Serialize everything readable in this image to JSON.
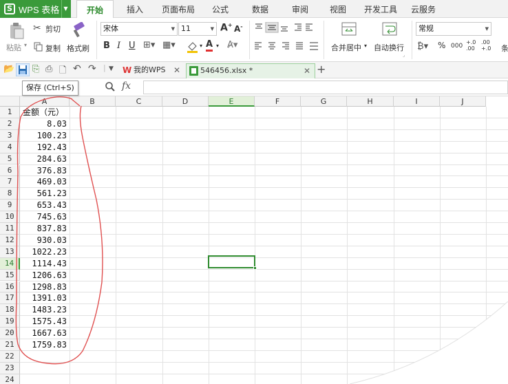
{
  "app": {
    "name": "WPS 表格",
    "logo_letter": "S"
  },
  "menu_tabs": [
    "开始",
    "插入",
    "页面布局",
    "公式",
    "数据",
    "审阅",
    "视图",
    "开发工具",
    "云服务"
  ],
  "active_menu_tab": "开始",
  "ribbon": {
    "paste": "粘贴",
    "cut": "剪切",
    "copy": "复制",
    "format_painter": "格式刷",
    "font_name": "宋体",
    "font_size": "11",
    "merge_center": "合并居中",
    "auto_wrap": "自动换行",
    "number_format": "常规",
    "percent": "%",
    "comma": "000",
    "inc_decimal": "+.0 .00",
    "dec_decimal": ".00 +.0",
    "cond_fmt_partial": "条"
  },
  "doc_tabs": [
    {
      "label": "我的WPS",
      "active": false
    },
    {
      "label": "546456.xlsx *",
      "active": true
    }
  ],
  "tooltip": "保存 (Ctrl+S)",
  "formula_bar": {
    "fx": "fx",
    "value": ""
  },
  "sheet": {
    "columns": [
      "A",
      "B",
      "C",
      "D",
      "E",
      "F",
      "G",
      "H",
      "I",
      "J"
    ],
    "selected_column": "E",
    "selected_row": "14",
    "rows": [
      "1",
      "2",
      "3",
      "4",
      "5",
      "6",
      "7",
      "8",
      "9",
      "10",
      "11",
      "12",
      "13",
      "14",
      "15",
      "16",
      "17",
      "18",
      "19",
      "20",
      "21",
      "22",
      "23",
      "24"
    ],
    "column_a": [
      "金额（元）",
      "8.03",
      "100.23",
      "192.43",
      "284.63",
      "376.83",
      "469.03",
      "561.23",
      "653.43",
      "745.63",
      "837.83",
      "930.03",
      "1022.23",
      "1114.43",
      "1206.63",
      "1298.83",
      "1391.03",
      "1483.23",
      "1575.43",
      "1667.63",
      "1759.83"
    ],
    "annotation_color": "#e05050"
  }
}
